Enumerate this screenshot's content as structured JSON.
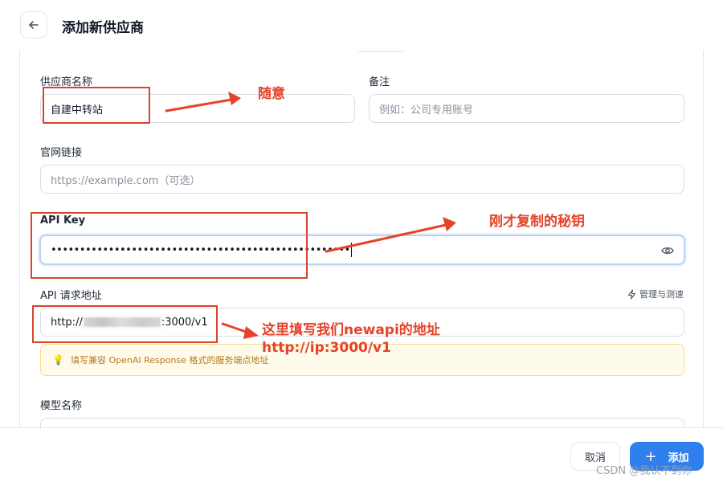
{
  "header": {
    "title": "添加新供应商",
    "back_icon": "arrow-left-icon"
  },
  "form": {
    "name": {
      "label": "供应商名称",
      "value": "自建中转站"
    },
    "notes": {
      "label": "备注",
      "placeholder": "例如：公司专用账号"
    },
    "website": {
      "label": "官网链接",
      "placeholder": "https://example.com（可选）"
    },
    "api_key": {
      "label": "API Key",
      "masked_value": "••••••••••••••••••••••••••••••••••••••••••••••••••••",
      "eye_icon": "eye-icon"
    },
    "endpoint": {
      "label": "API 请求地址",
      "value_prefix": "http://",
      "value_suffix": ":3000/v1",
      "manage_label": "管理与测速",
      "manage_icon": "lightning-icon",
      "hint": "填写兼容 OpenAI Response 格式的服务端点地址",
      "hint_icon": "lightbulb-icon"
    },
    "model": {
      "label": "模型名称"
    }
  },
  "footer": {
    "cancel_label": "取消",
    "add_label": "添加",
    "add_icon": "plus-icon"
  },
  "annotations": {
    "name_note": "随意",
    "key_note": "刚才复制的秘钥",
    "endpoint_note_line1": "这里填写我们newapi的地址",
    "endpoint_note_line2": "http://ip:3000/v1",
    "color": "#e5432a"
  },
  "watermark": "CSDN @我认不到你"
}
